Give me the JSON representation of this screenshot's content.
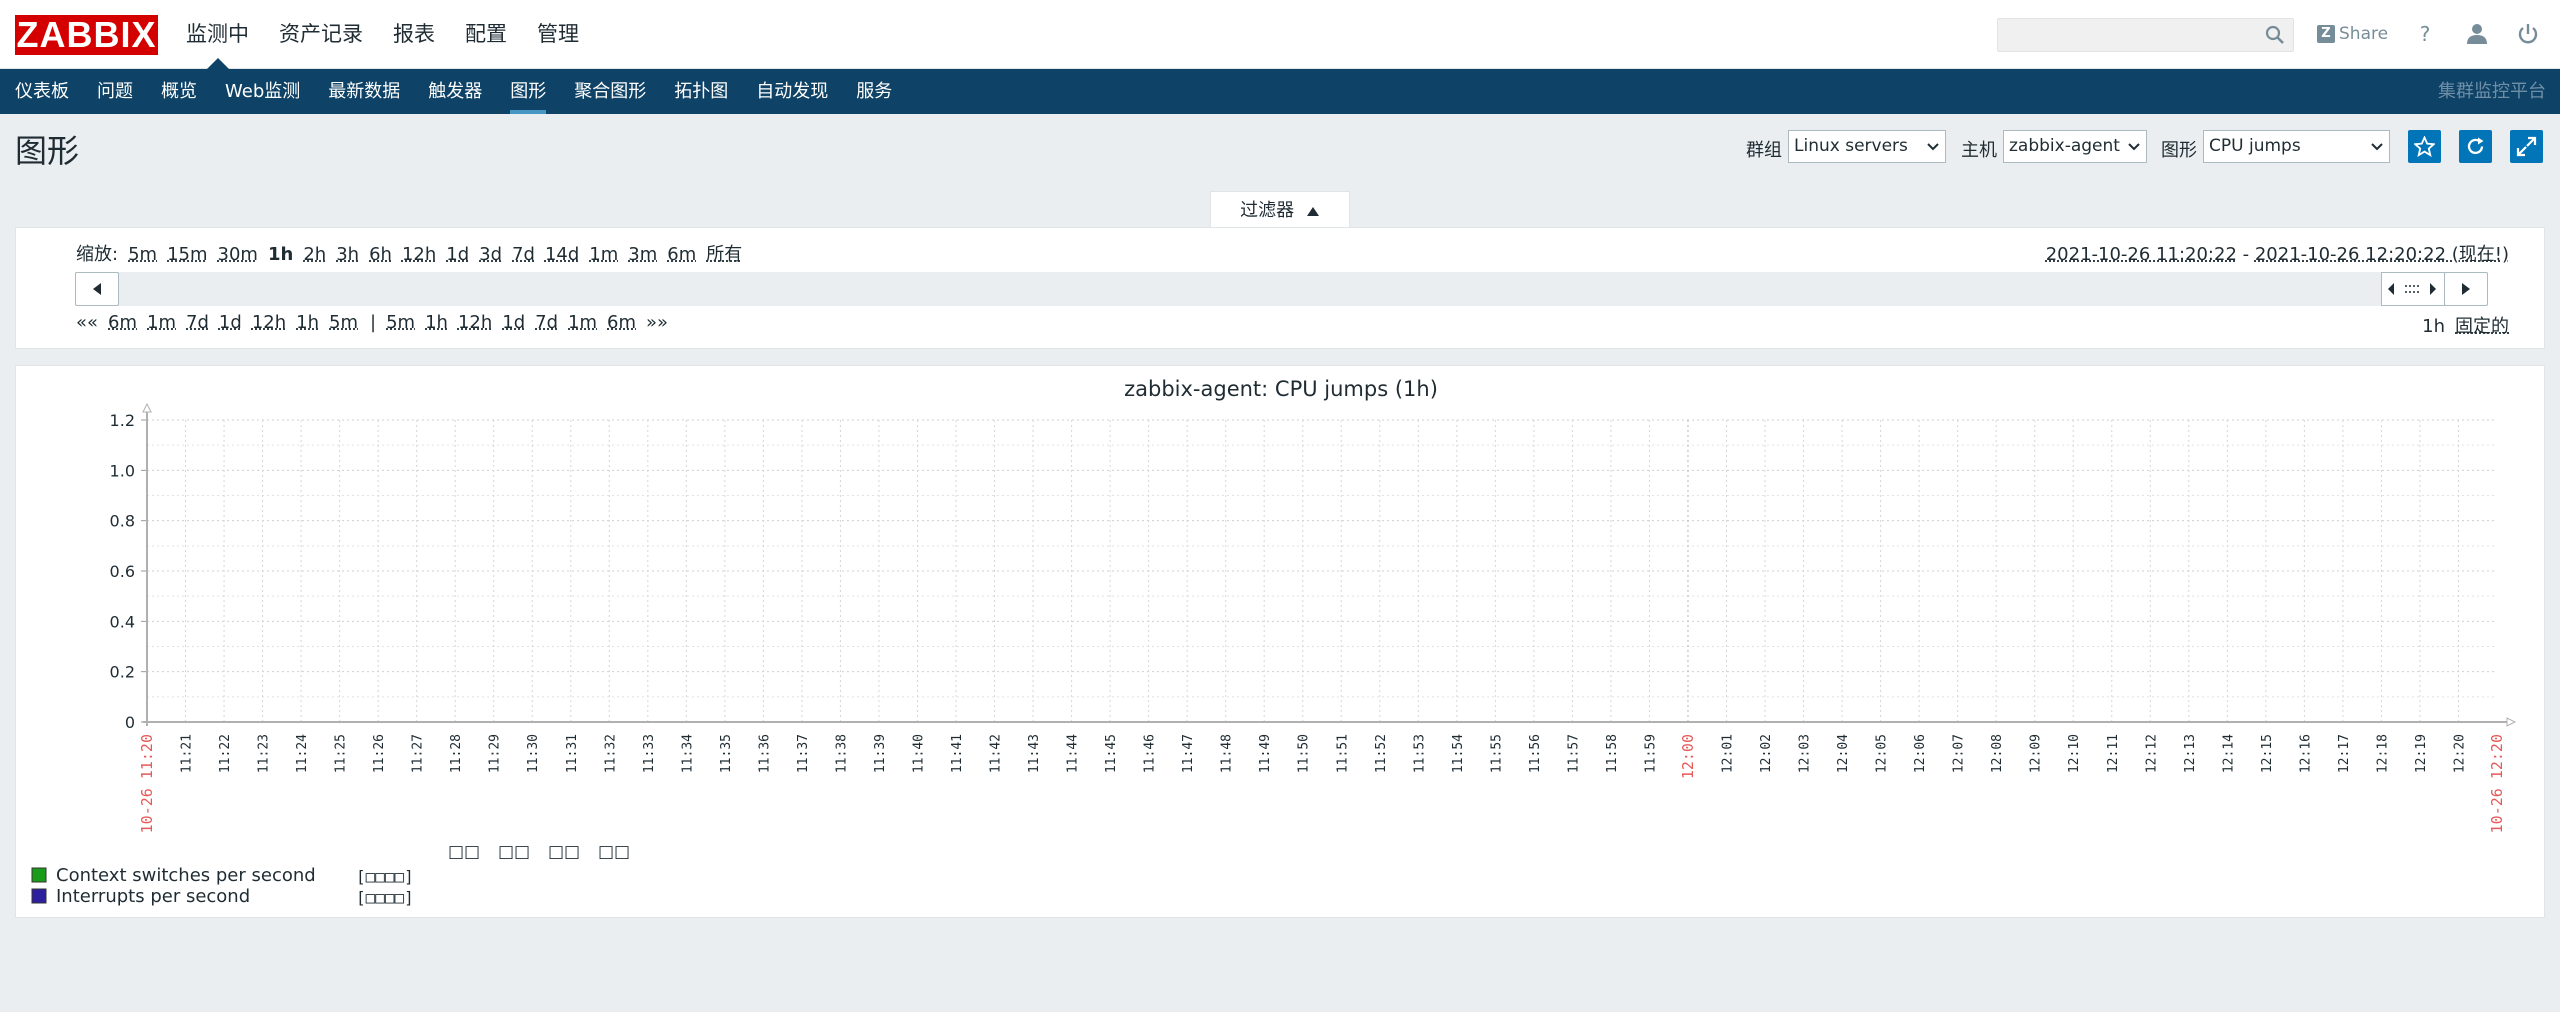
{
  "logo": "ZABBIX",
  "top_nav": [
    {
      "label": "监测中",
      "active": true
    },
    {
      "label": "资产记录",
      "active": false
    },
    {
      "label": "报表",
      "active": false
    },
    {
      "label": "配置",
      "active": false
    },
    {
      "label": "管理",
      "active": false
    }
  ],
  "search": {
    "value": "",
    "placeholder": ""
  },
  "share_label": "Share",
  "sub_nav": [
    {
      "label": "仪表板",
      "active": false
    },
    {
      "label": "问题",
      "active": false
    },
    {
      "label": "概览",
      "active": false
    },
    {
      "label": "Web监测",
      "active": false
    },
    {
      "label": "最新数据",
      "active": false
    },
    {
      "label": "触发器",
      "active": false
    },
    {
      "label": "图形",
      "active": true
    },
    {
      "label": "聚合图形",
      "active": false
    },
    {
      "label": "拓扑图",
      "active": false
    },
    {
      "label": "自动发现",
      "active": false
    },
    {
      "label": "服务",
      "active": false
    }
  ],
  "sub_nav_right": "集群监控平台",
  "page_title": "图形",
  "filters": {
    "group_label": "群组",
    "group_value": "Linux servers",
    "host_label": "主机",
    "host_value": "zabbix-agent",
    "graph_label": "图形",
    "graph_value": "CPU jumps"
  },
  "filter_tab": "过滤器",
  "zoom": {
    "label": "缩放:",
    "options": [
      "5m",
      "15m",
      "30m",
      "1h",
      "2h",
      "3h",
      "6h",
      "12h",
      "1d",
      "3d",
      "7d",
      "14d",
      "1m",
      "3m",
      "6m",
      "所有"
    ],
    "selected": "1h"
  },
  "time_range": {
    "from": "2021-10-26 11:20:22",
    "to": "2021-10-26 12:20:22 (现在!)"
  },
  "nav_back": {
    "arrow": "««",
    "options": [
      "6m",
      "1m",
      "7d",
      "1d",
      "12h",
      "1h",
      "5m"
    ]
  },
  "nav_fwd": {
    "arrow": "»»",
    "options": [
      "5m",
      "1h",
      "12h",
      "1d",
      "7d",
      "1m",
      "6m"
    ]
  },
  "period_value": "1h",
  "fixed_label": "固定的",
  "chart_data": {
    "type": "line",
    "title": "zabbix-agent: CPU jumps (1h)",
    "ylim": [
      0,
      1.2
    ],
    "y_ticks": [
      "0",
      "0.2",
      "0.4",
      "0.6",
      "0.8",
      "1.0",
      "1.2"
    ],
    "x_start_label": "10-26 11:20",
    "x_end_label": "10-26 12:20",
    "x_tick_labels": [
      "11:21",
      "11:22",
      "11:23",
      "11:24",
      "11:25",
      "11:26",
      "11:27",
      "11:28",
      "11:29",
      "11:30",
      "11:31",
      "11:32",
      "11:33",
      "11:34",
      "11:35",
      "11:36",
      "11:37",
      "11:38",
      "11:39",
      "11:40",
      "11:41",
      "11:42",
      "11:43",
      "11:44",
      "11:45",
      "11:46",
      "11:47",
      "11:48",
      "11:49",
      "11:50",
      "11:51",
      "11:52",
      "11:53",
      "11:54",
      "11:55",
      "11:56",
      "11:57",
      "11:58",
      "11:59",
      "12:00",
      "12:01",
      "12:02",
      "12:03",
      "12:04",
      "12:05",
      "12:06",
      "12:07",
      "12:08",
      "12:09",
      "12:10",
      "12:11",
      "12:12",
      "12:13",
      "12:14",
      "12:15",
      "12:16",
      "12:17",
      "12:18",
      "12:19",
      "12:20"
    ],
    "highlight_tick": "12:00",
    "grid": true,
    "legend_headers": [
      "□□",
      "□□",
      "□□",
      "□□"
    ],
    "series": [
      {
        "name": "Context switches per second",
        "color": "#1a9c1a",
        "values": [],
        "note": "[□□□□]"
      },
      {
        "name": "Interrupts per second",
        "color": "#2d1f9e",
        "values": [],
        "note": "[□□□□]"
      }
    ]
  },
  "colors": {
    "brand": "#d40000",
    "nav": "#0e4266",
    "accent": "#0275b8",
    "highlight": "#e45959"
  }
}
